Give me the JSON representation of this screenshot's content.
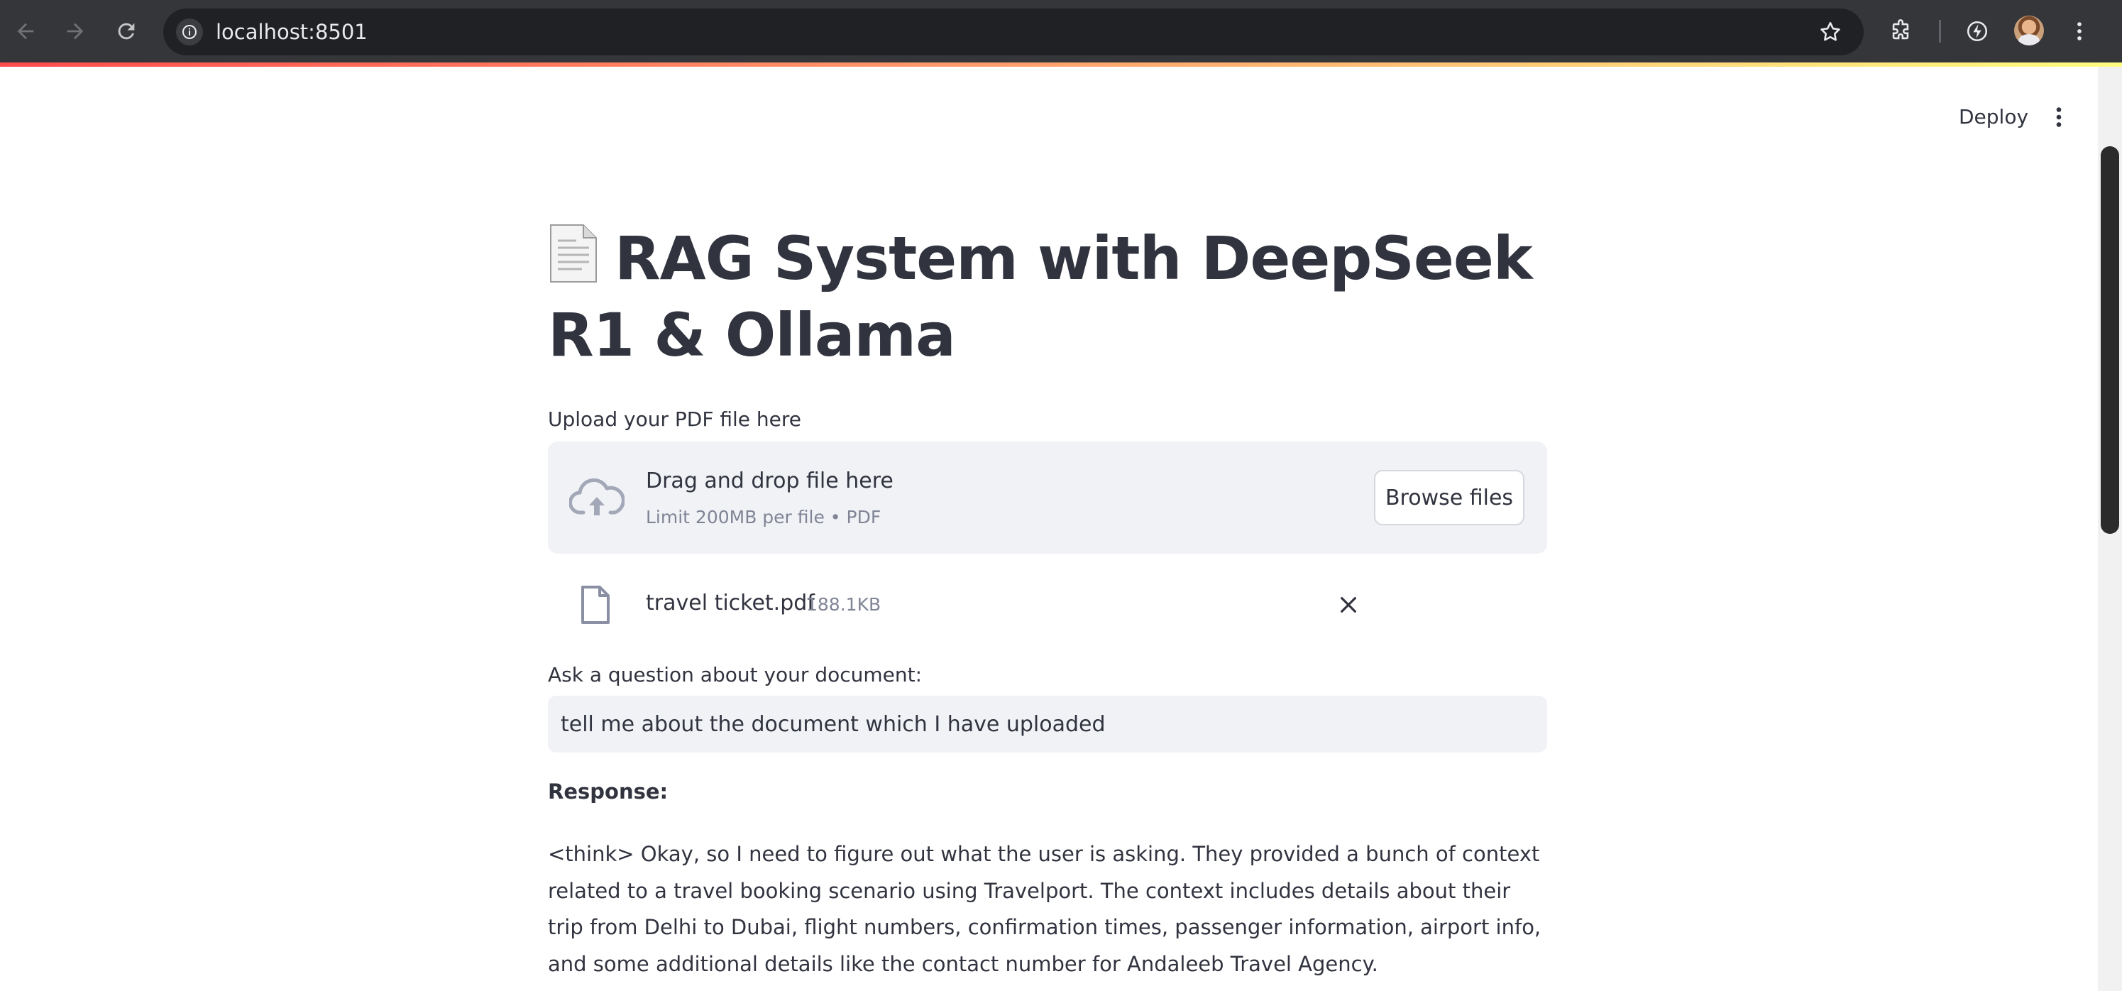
{
  "browser": {
    "url": "localhost:8501"
  },
  "header": {
    "deploy_label": "Deploy"
  },
  "page": {
    "title": "RAG System with DeepSeek R1 & Ollama",
    "title_icon": "page-facing-up-emoji"
  },
  "uploader": {
    "label": "Upload your PDF file here",
    "drop_text": "Drag and drop file here",
    "limit_text": "Limit 200MB per file • PDF",
    "browse_label": "Browse files",
    "file": {
      "name": "travel ticket.pdf",
      "size": "188.1KB"
    }
  },
  "question": {
    "label": "Ask a question about your document:",
    "value": "tell me about the document which I have uploaded"
  },
  "response": {
    "title": "Response:",
    "text": "<think> Okay, so I need to figure out what the user is asking. They provided a bunch of context related to a travel booking scenario using Travelport. The context includes details about their trip from Delhi to Dubai, flight numbers, confirmation times, passenger information, airport info, and some additional details like the contact number for Andaleeb Travel Agency."
  },
  "colors": {
    "chrome_bg": "#35363a",
    "omnibox_bg": "#202124",
    "text": "#31333f",
    "muted": "#808495",
    "widget_bg": "#f0f2f6",
    "accent_gradient_start": "#ff4b4b",
    "accent_gradient_end": "#fffd80"
  }
}
